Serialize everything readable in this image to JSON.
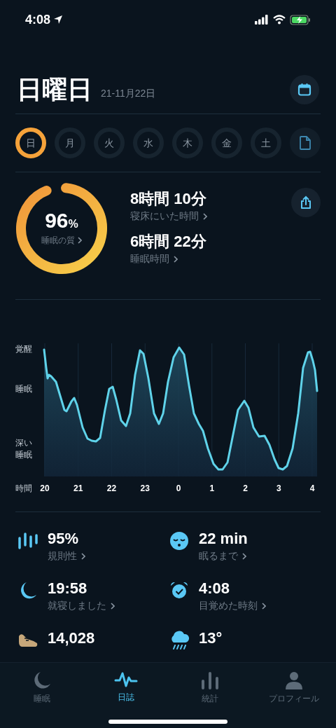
{
  "status_bar": {
    "time": "4:08"
  },
  "header": {
    "title": "日曜日",
    "date": "21-11月22日"
  },
  "days": [
    {
      "label": "日",
      "selected": true
    },
    {
      "label": "月",
      "selected": false
    },
    {
      "label": "火",
      "selected": false
    },
    {
      "label": "水",
      "selected": false
    },
    {
      "label": "木",
      "selected": false
    },
    {
      "label": "金",
      "selected": false
    },
    {
      "label": "土",
      "selected": false
    }
  ],
  "summary": {
    "quality": {
      "value": "96",
      "unit": "%",
      "label": "睡眠の質",
      "level": 0.96
    },
    "metrics": [
      {
        "value": "8時間 10分",
        "label": "寝床にいた時間"
      },
      {
        "value": "6時間 22分",
        "label": "睡眠時間"
      }
    ]
  },
  "chart": {
    "y_labels": [
      "覚醒",
      "睡眠",
      "深い睡眠"
    ],
    "x_title": "時間",
    "x_labels": [
      "20",
      "21",
      "22",
      "23",
      "0",
      "1",
      "2",
      "3",
      "4"
    ]
  },
  "stats": [
    {
      "kind": "regularity",
      "value": "95%",
      "label": "規則性"
    },
    {
      "kind": "fall_asleep",
      "value": "22 min",
      "label": "眠るまで"
    },
    {
      "kind": "bedtime",
      "value": "19:58",
      "label": "就寝しました"
    },
    {
      "kind": "wake",
      "value": "4:08",
      "label": "目覚めた時刻"
    },
    {
      "kind": "steps",
      "value": "14,028"
    },
    {
      "kind": "weather",
      "value": "13°"
    }
  ],
  "tab_bar": [
    {
      "kind": "sleep",
      "label": "睡眠",
      "selected": false
    },
    {
      "kind": "journal",
      "label": "日誌",
      "selected": true
    },
    {
      "kind": "stats",
      "label": "統計",
      "selected": false
    },
    {
      "kind": "profile",
      "label": "プロフィール",
      "selected": false
    }
  ]
}
